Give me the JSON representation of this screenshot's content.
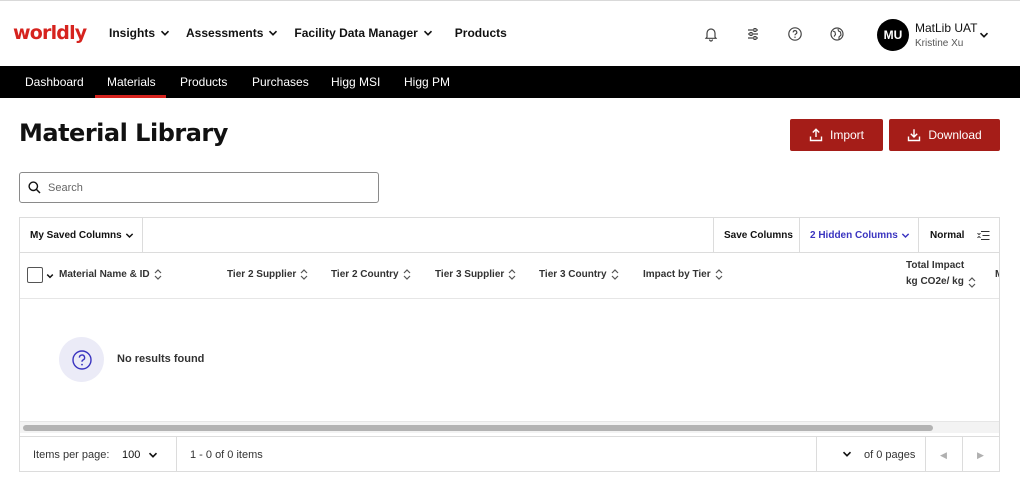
{
  "brand": {
    "logo_text": "worldly",
    "logo_color": "#d6231e"
  },
  "top_nav": [
    {
      "label": "Insights",
      "has_dropdown": true
    },
    {
      "label": "Assessments",
      "has_dropdown": true
    },
    {
      "label": "Facility Data Manager",
      "has_dropdown": true
    },
    {
      "label": "Products",
      "has_dropdown": false
    }
  ],
  "header_icons": [
    "bell-icon",
    "sliders-icon",
    "help-icon",
    "globe-icon"
  ],
  "user": {
    "initials": "MU",
    "name": "MatLib UAT",
    "subname": "Kristine Xu"
  },
  "sub_nav": [
    {
      "label": "Dashboard",
      "active": false
    },
    {
      "label": "Materials",
      "active": true
    },
    {
      "label": "Products",
      "active": false
    },
    {
      "label": "Purchases",
      "active": false
    },
    {
      "label": "Higg MSI",
      "active": false
    },
    {
      "label": "Higg PM",
      "active": false
    }
  ],
  "page": {
    "title": "Material Library",
    "import_label": "Import",
    "download_label": "Download",
    "accent_color": "#a51d18"
  },
  "search": {
    "placeholder": "Search",
    "value": ""
  },
  "grid": {
    "saved_columns_label": "My Saved Columns",
    "save_columns_label": "Save Columns",
    "hidden_columns_label": "2 Hidden Columns",
    "density_label": "Normal",
    "columns": [
      {
        "label": "Material Name & ID"
      },
      {
        "label": "Tier 2 Supplier"
      },
      {
        "label": "Tier 2 Country"
      },
      {
        "label": "Tier 3 Supplier"
      },
      {
        "label": "Tier 3 Country"
      },
      {
        "label": "Impact by Tier"
      },
      {
        "label_line1": "Total Impact",
        "label_line2": "kg CO2e/ kg"
      },
      {
        "label": "M"
      }
    ],
    "empty_message": "No results found"
  },
  "pager": {
    "items_per_page_label": "Items per page:",
    "items_per_page_value": "100",
    "range_text": "1 - 0 of 0 items",
    "pages_text": "of 0 pages",
    "current_page": ""
  }
}
